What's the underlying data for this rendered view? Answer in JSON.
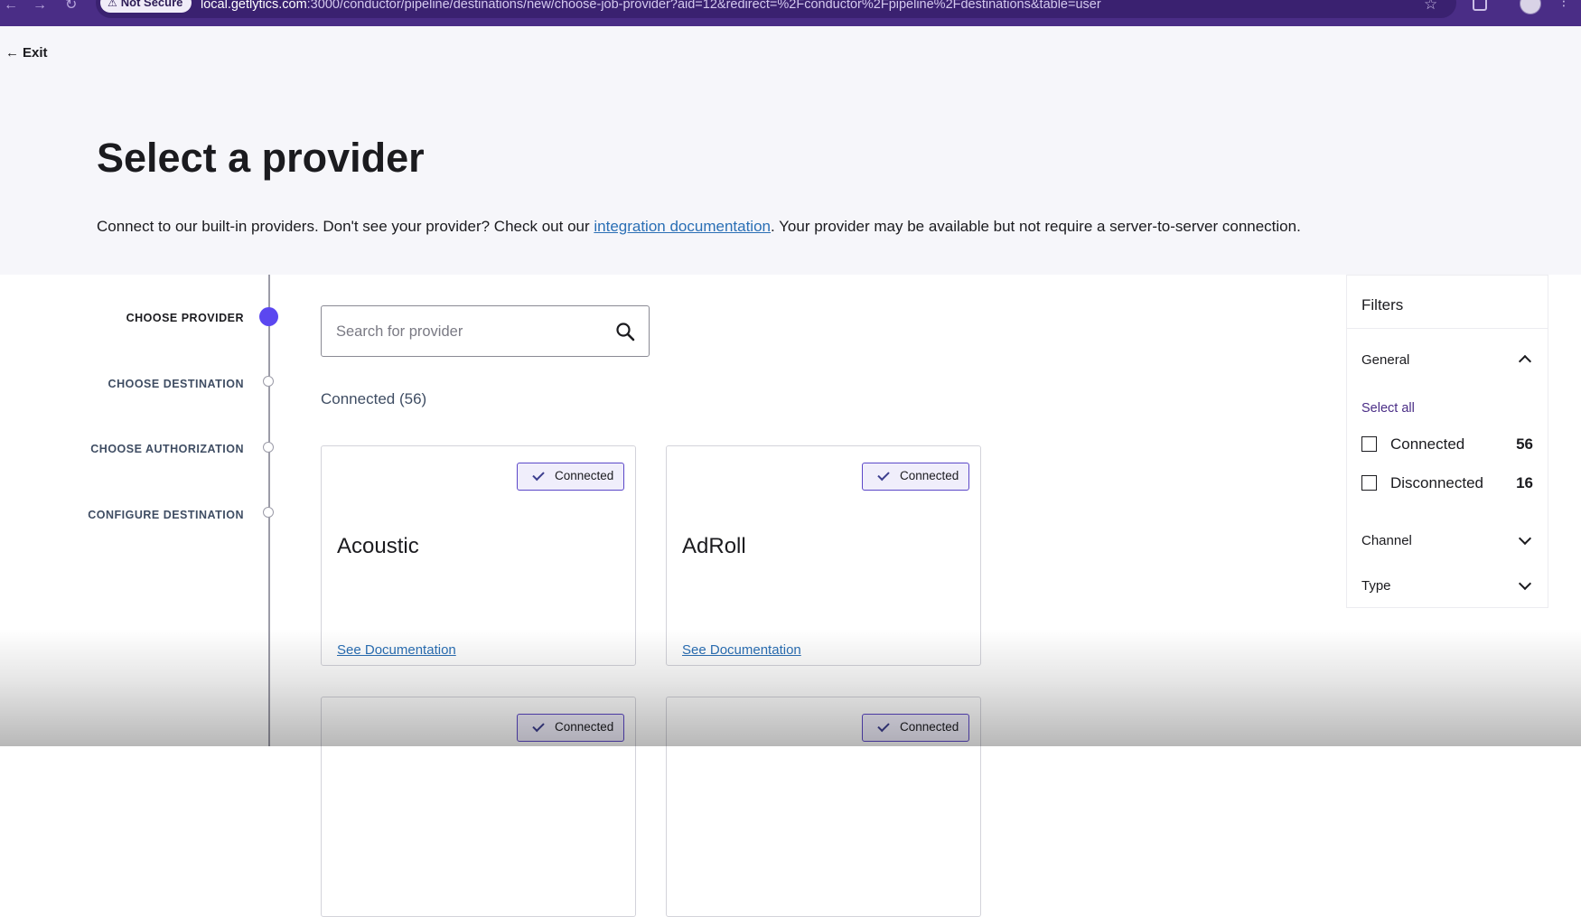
{
  "browser": {
    "security_label": "Not Secure",
    "url_host": "local.getlytics.com",
    "url_rest": ":3000/conductor/pipeline/destinations/new/choose-job-provider?aid=12&redirect=%2Fconductor%2Fpipeline%2Fdestinations&table=user"
  },
  "header": {
    "exit_label": "Exit",
    "title": "Select a provider",
    "intro_before": "Connect to our built-in providers. Don't see your provider? Check out our ",
    "intro_link": "integration documentation",
    "intro_after": ". Your provider may be available but not require a server-to-server connection."
  },
  "steps": [
    {
      "label": "CHOOSE PROVIDER",
      "active": true
    },
    {
      "label": "CHOOSE DESTINATION",
      "active": false
    },
    {
      "label": "CHOOSE AUTHORIZATION",
      "active": false
    },
    {
      "label": "CONFIGURE DESTINATION",
      "active": false
    }
  ],
  "search": {
    "placeholder": "Search for provider",
    "value": ""
  },
  "section": {
    "heading": "Connected (56)"
  },
  "cards": [
    {
      "name": "Acoustic",
      "status": "Connected",
      "doc_link": "See Documentation"
    },
    {
      "name": "AdRoll",
      "status": "Connected",
      "doc_link": "See Documentation"
    },
    {
      "name": "",
      "status": "Connected",
      "doc_link": ""
    },
    {
      "name": "",
      "status": "Connected",
      "doc_link": ""
    }
  ],
  "filters": {
    "title": "Filters",
    "general": {
      "label": "General",
      "select_all": "Select all",
      "options": [
        {
          "label": "Connected",
          "count": "56",
          "checked": false
        },
        {
          "label": "Disconnected",
          "count": "16",
          "checked": false
        }
      ]
    },
    "channel": {
      "label": "Channel"
    },
    "type": {
      "label": "Type"
    }
  },
  "colors": {
    "browser_bar": "#4a2d86",
    "accent": "#5b47f0",
    "link": "#2a6fb5",
    "header_bg": "#f6f6fa"
  }
}
